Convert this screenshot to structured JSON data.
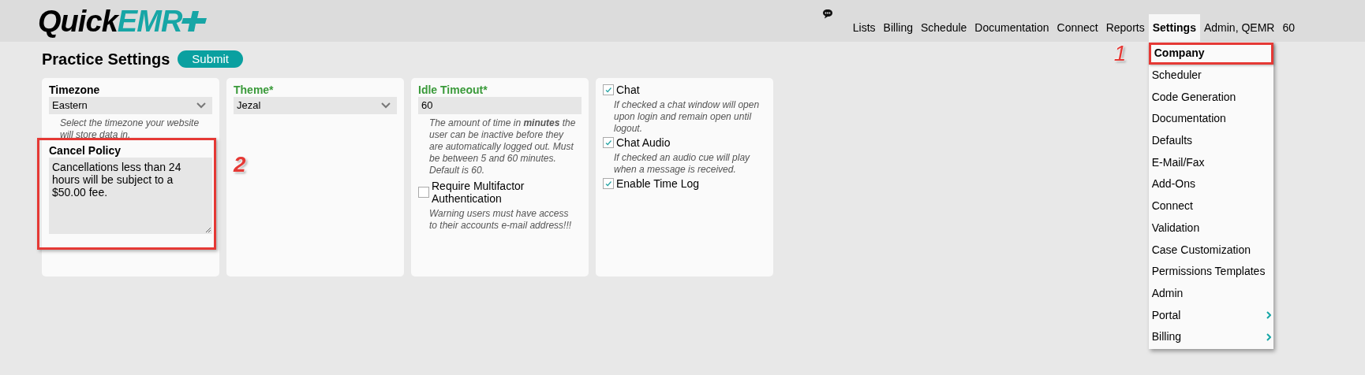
{
  "logo": {
    "part1": "Quick",
    "part2": "EMR"
  },
  "nav": [
    {
      "label": "Lists",
      "selected": false
    },
    {
      "label": "Billing",
      "selected": false
    },
    {
      "label": "Schedule",
      "selected": false
    },
    {
      "label": "Documentation",
      "selected": false
    },
    {
      "label": "Connect",
      "selected": false
    },
    {
      "label": "Reports",
      "selected": false
    },
    {
      "label": "Settings",
      "selected": true
    },
    {
      "label": "Admin, QEMR",
      "selected": false
    },
    {
      "label": "60",
      "selected": false
    }
  ],
  "settings_menu": [
    {
      "label": "Company",
      "selected": true,
      "submenu": false,
      "highlighted": true,
      "marker": "1"
    },
    {
      "label": "Scheduler",
      "selected": false,
      "submenu": false
    },
    {
      "label": "Code Generation",
      "selected": false,
      "submenu": false
    },
    {
      "label": "Documentation",
      "selected": false,
      "submenu": false
    },
    {
      "label": "Defaults",
      "selected": false,
      "submenu": false
    },
    {
      "label": "E-Mail/Fax",
      "selected": false,
      "submenu": false
    },
    {
      "label": "Add-Ons",
      "selected": false,
      "submenu": false
    },
    {
      "label": "Connect",
      "selected": false,
      "submenu": false
    },
    {
      "label": "Validation",
      "selected": false,
      "submenu": false
    },
    {
      "label": "Case Customization",
      "selected": false,
      "submenu": false
    },
    {
      "label": "Permissions Templates",
      "selected": false,
      "submenu": false
    },
    {
      "label": "Admin",
      "selected": false,
      "submenu": false
    },
    {
      "label": "Portal",
      "selected": false,
      "submenu": true
    },
    {
      "label": "Billing",
      "selected": false,
      "submenu": true
    }
  ],
  "page": {
    "title": "Practice Settings",
    "submit": "Submit"
  },
  "cards": [
    {
      "fields": [
        {
          "kind": "select",
          "label": "Timezone",
          "required": false,
          "value": "Eastern",
          "hint": "Select the timezone your website will store data in."
        },
        {
          "kind": "textarea",
          "label": "Cancel Policy",
          "required": false,
          "value": "Cancellations less than 24 hours will be subject to a $50.00 fee.",
          "highlighted": true,
          "marker": "2"
        }
      ]
    },
    {
      "fields": [
        {
          "kind": "select",
          "label": "Theme*",
          "required": true,
          "value": "Jezal"
        }
      ]
    },
    {
      "fields": [
        {
          "kind": "text",
          "label": "Idle Timeout*",
          "required": true,
          "value": "60",
          "hint": "The amount of time in **minutes** the user can be inactive before they are automatically logged out. Must be between 5 and 60 minutes. Default is 60."
        },
        {
          "kind": "checkbox",
          "label": "Require Multifactor Authentication",
          "checked": false,
          "hint": "Warning users must have access to their accounts e-mail address!!!"
        }
      ]
    },
    {
      "fields": [
        {
          "kind": "checkbox",
          "label": "Chat",
          "checked": true,
          "hint": "If checked a chat window will open upon login and remain open until logout."
        },
        {
          "kind": "checkbox",
          "label": "Chat Audio",
          "checked": true,
          "hint": "If checked an audio cue will play when a message is received."
        },
        {
          "kind": "checkbox",
          "label": "Enable Time Log",
          "checked": true
        }
      ]
    }
  ]
}
